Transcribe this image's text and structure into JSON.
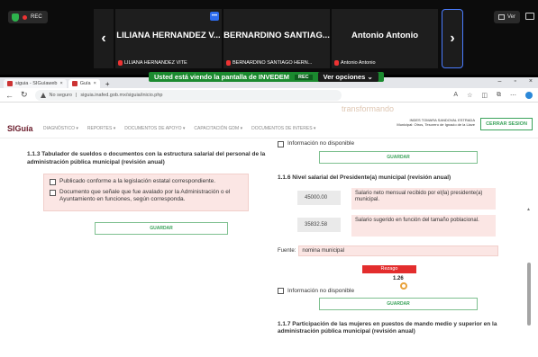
{
  "zoom": {
    "rec_label": "REC",
    "view_label": "Ver",
    "participants": [
      {
        "name": "LILIANA HERNANDEZ V...",
        "label": "LILIANA HERNANDEZ VITE"
      },
      {
        "name": "BERNARDINO SANTIAG...",
        "label": "BERNARDINO SANTIAGO HERN..."
      },
      {
        "name": "Antonio Antonio",
        "label": "Antonio Antonio"
      }
    ],
    "share_banner": "Usted está viendo la pantalla de  INVEDEM",
    "banner_rec": "REC",
    "view_options": "Ver opciones ⌄"
  },
  "browser": {
    "tabs": [
      "siguia - SIGuíaweb",
      "Guía"
    ],
    "new_tab": "+",
    "url_warning": "No seguro",
    "url": "siguia.inafed.gob.mx/siguia/inicio.php"
  },
  "site": {
    "logo": "SIGuía",
    "watermark": "transformando",
    "nav": [
      "DIAGNÓSTICO ▾",
      "REPORTES ▾",
      "DOCUMENTOS DE APOYO ▾",
      "CAPACITACIÓN GDM ▾",
      "DOCUMENTOS DE INTERES ▾"
    ],
    "org_text": "INDES TOMARA SANDOVAL ESTRADA Municipal: Otros, Tesorero de Ignacio de la Llave",
    "logout": "CERRAR SESION"
  },
  "left": {
    "title": "1.1.3 Tabulador de sueldos o documentos con la estructura salarial del personal de la administración pública municipal (revisión anual)",
    "options": [
      "Publicado conforme a la legislación estatal correspondiente.",
      "Documento que señale que fue avalado por la Administración o el Ayuntamiento en funciones, según corresponda."
    ],
    "save": "GUARDAR"
  },
  "right": {
    "no_info": "Información no disponible",
    "save": "GUARDAR",
    "section_116": "1.1.6 Nivel salarial del Presidente(a) municipal (revisión anual)",
    "salaries": [
      {
        "value": "45000.00",
        "desc": "Salario neto mensual recibido por el(la) presidente(a) municipal."
      },
      {
        "value": "35832.58",
        "desc": "Salario sugerido en función del tamaño poblacional."
      }
    ],
    "source_label": "Fuente:",
    "source_value": "nomina municipal",
    "rezago": "Rezago",
    "score": "1.26",
    "no_info_2": "Información no disponible",
    "save_2": "GUARDAR",
    "section_117": "1.1.7 Participación de las mujeres en puestos de mando medio y superior en la administración pública municipal (revisión anual)"
  }
}
